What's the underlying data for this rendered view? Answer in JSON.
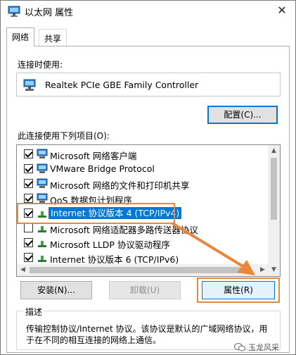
{
  "window": {
    "title": "以太网 属性",
    "close_glyph": "✕"
  },
  "tabs": [
    {
      "label": "网络",
      "active": true
    },
    {
      "label": "共享",
      "active": false
    }
  ],
  "connect_using_label": "连接时使用:",
  "adapter_name": "Realtek PCIe GBE Family Controller",
  "configure_button": "配置(C)...",
  "items_label": "此连接使用下列项目(O):",
  "items": [
    {
      "label": "Microsoft 网络客户端",
      "checked": true,
      "icon": "network-client-icon"
    },
    {
      "label": "VMware Bridge Protocol",
      "checked": true,
      "icon": "network-protocol-icon"
    },
    {
      "label": "Microsoft 网络的文件和打印机共享",
      "checked": true,
      "icon": "file-printer-sharing-icon"
    },
    {
      "label": "QoS 数据包计划程序",
      "checked": true,
      "icon": "qos-icon"
    },
    {
      "label": "Internet 协议版本 4 (TCP/IPv4)",
      "checked": true,
      "icon": "protocol-icon",
      "selected": true
    },
    {
      "label": "Microsoft 网络适配器多路传送器协议",
      "checked": false,
      "icon": "protocol-icon"
    },
    {
      "label": "Microsoft LLDP 协议驱动程序",
      "checked": true,
      "icon": "protocol-icon"
    },
    {
      "label": "Internet 协议版本 6 (TCP/IPv6)",
      "checked": true,
      "icon": "protocol-icon"
    }
  ],
  "buttons": {
    "install": "安装(N)...",
    "uninstall": "卸载(U)",
    "properties": "属性(R)"
  },
  "description": {
    "title": "描述",
    "text": "传输控制协议/Internet 协议。该协议是默认的广域网络协议，用于在不同的相互连接的网络上通信。"
  },
  "watermark": "玉龙风采",
  "colors": {
    "accent": "#0078d7",
    "highlight": "#e9883c"
  }
}
